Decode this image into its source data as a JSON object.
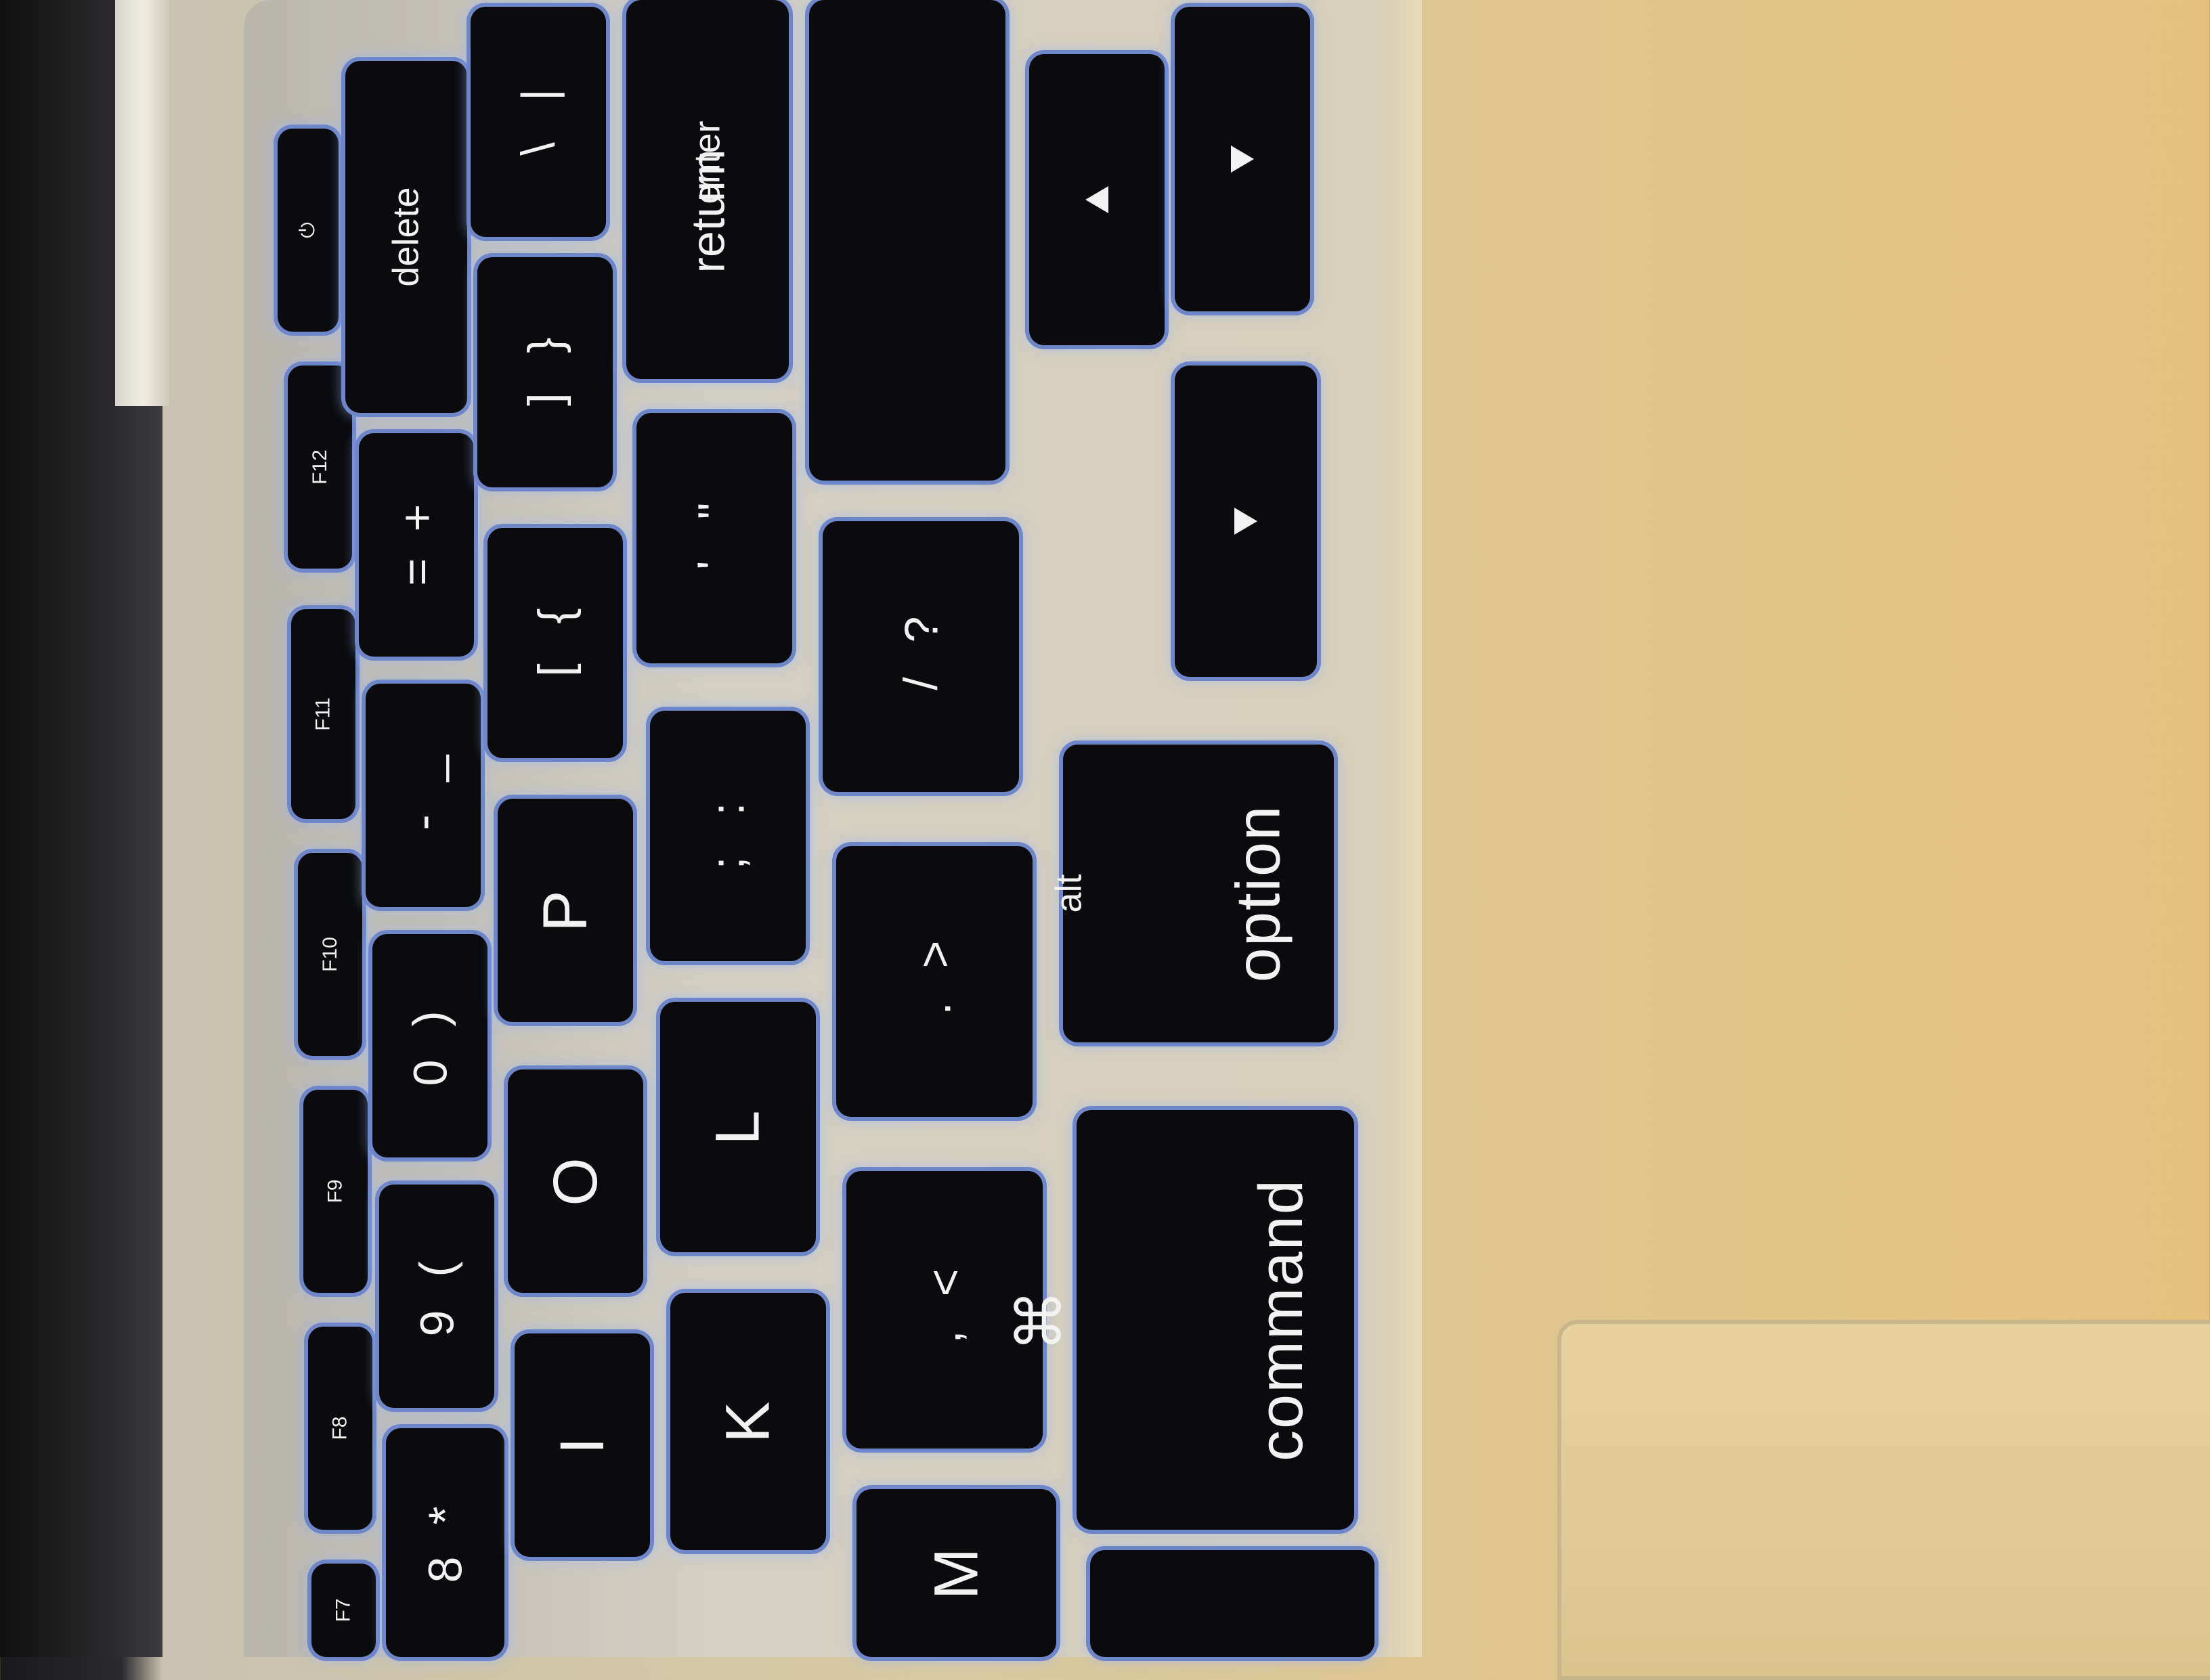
{
  "function_row": [
    {
      "key": "power",
      "label": "⏻"
    },
    {
      "key": "f12",
      "label": "F12"
    },
    {
      "key": "f11",
      "label": "F11"
    },
    {
      "key": "f10",
      "label": "F10"
    },
    {
      "key": "f9",
      "label": "F9"
    },
    {
      "key": "f8",
      "label": "F8"
    },
    {
      "key": "f7",
      "label": "F7"
    }
  ],
  "number_row": {
    "delete": "delete",
    "plus": "+",
    "equals": "=",
    "underscore": "_",
    "minus": "-",
    "rparen": ")",
    "zero": "0",
    "lparen": "(",
    "nine": "9",
    "star": "*",
    "eight": "8"
  },
  "top_row": {
    "pipe": "|",
    "backslash": "\\",
    "rbrace": "}",
    "rbracket": "]",
    "lbrace": "{",
    "lbracket": "[",
    "p": "P",
    "o": "O",
    "i": "I"
  },
  "home_row": {
    "return_top": "enter",
    "return_bottom": "return",
    "quote": "\"",
    "apos": "'",
    "colon": ":",
    "semicolon": ";",
    "l": "L",
    "k": "K"
  },
  "bottom_row": {
    "question": "?",
    "slash": "/",
    "gt": ">",
    "period": ".",
    "lt": "<",
    "comma": ",",
    "m": "M"
  },
  "modifiers": {
    "option_alt": "alt",
    "option": "option",
    "command_symbol": "⌘",
    "command": "command"
  }
}
